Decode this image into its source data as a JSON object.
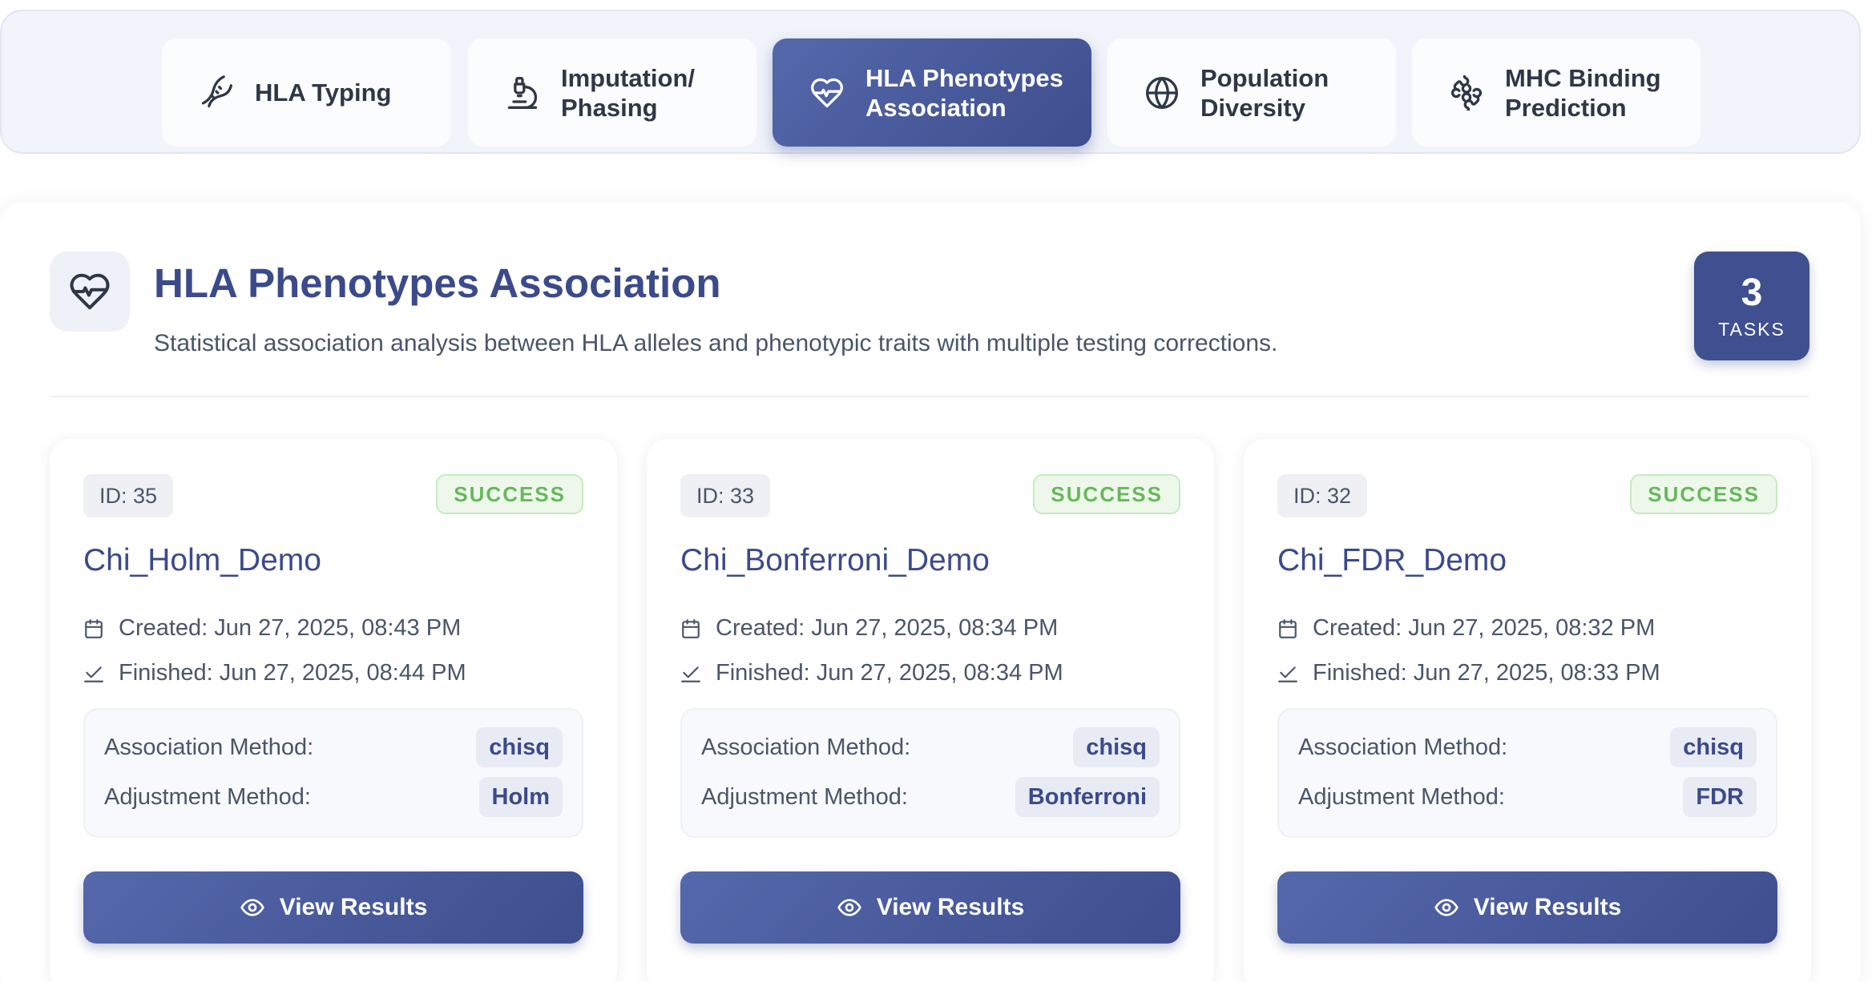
{
  "tabs": [
    {
      "label": "HLA Typing",
      "icon": "dna-icon",
      "active": false
    },
    {
      "label": "Imputation/\nPhasing",
      "icon": "microscope-icon",
      "active": false
    },
    {
      "label": "HLA Phenotypes\nAssociation",
      "icon": "heart-pulse-icon",
      "active": true
    },
    {
      "label": "Population\nDiversity",
      "icon": "globe-icon",
      "active": false
    },
    {
      "label": "MHC Binding\nPrediction",
      "icon": "puzzle-icon",
      "active": false
    }
  ],
  "header": {
    "icon": "heart-pulse-icon",
    "title": "HLA Phenotypes Association",
    "description": "Statistical association analysis between HLA alleles and phenotypic traits with multiple testing corrections.",
    "task_count": "3",
    "task_label": "TASKS"
  },
  "labels": {
    "association": "Association Method:",
    "adjustment": "Adjustment Method:",
    "view_results": "View Results"
  },
  "cards": [
    {
      "id": "ID: 35",
      "status": "SUCCESS",
      "title": "Chi_Holm_Demo",
      "created": "Created: Jun 27, 2025, 08:43 PM",
      "finished": "Finished: Jun 27, 2025, 08:44 PM",
      "association_method": "chisq",
      "adjustment_method": "Holm"
    },
    {
      "id": "ID: 33",
      "status": "SUCCESS",
      "title": "Chi_Bonferroni_Demo",
      "created": "Created: Jun 27, 2025, 08:34 PM",
      "finished": "Finished: Jun 27, 2025, 08:34 PM",
      "association_method": "chisq",
      "adjustment_method": "Bonferroni"
    },
    {
      "id": "ID: 32",
      "status": "SUCCESS",
      "title": "Chi_FDR_Demo",
      "created": "Created: Jun 27, 2025, 08:32 PM",
      "finished": "Finished: Jun 27, 2025, 08:33 PM",
      "association_method": "chisq",
      "adjustment_method": "FDR"
    }
  ],
  "colors": {
    "accent": "#3f4f8f",
    "title": "#3b4a8a",
    "success": "#67b85a"
  }
}
